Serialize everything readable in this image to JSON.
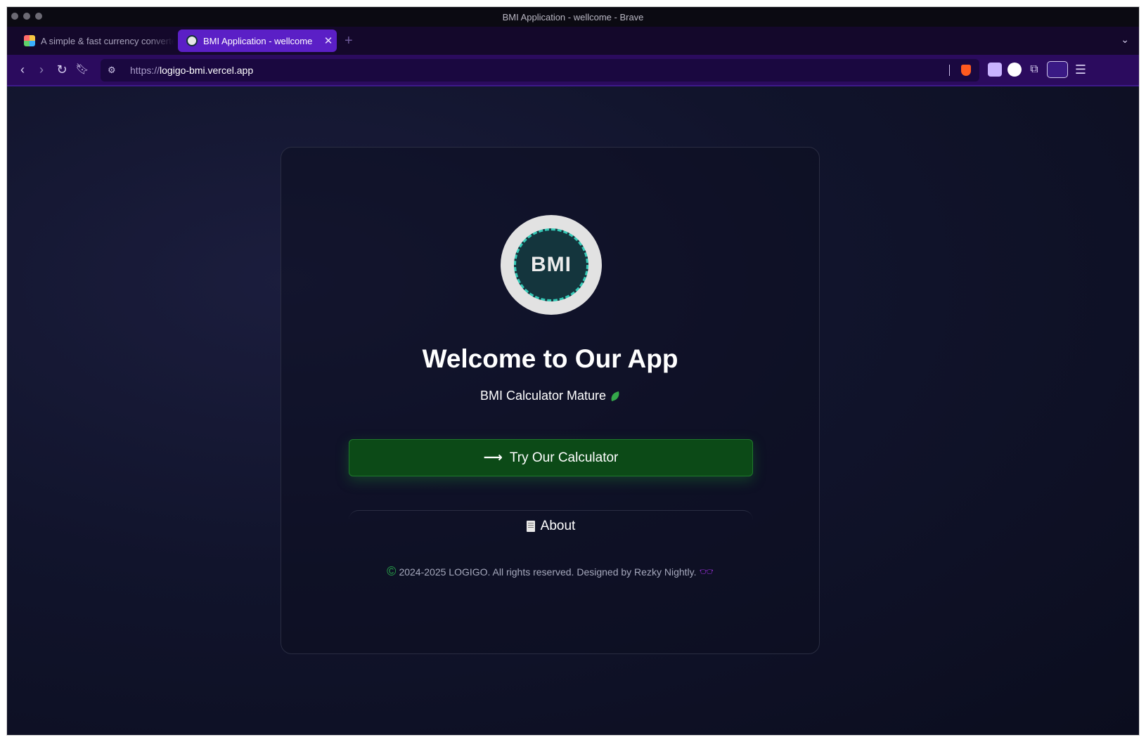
{
  "window": {
    "title": "BMI Application - wellcome - Brave"
  },
  "tabs": [
    {
      "label": "A simple & fast currency converter",
      "active": false
    },
    {
      "label": "BMI Application - wellcome",
      "active": true
    }
  ],
  "toolbar": {
    "url_scheme": "https://",
    "url_host": "logigo-bmi.vercel.app"
  },
  "page": {
    "logo_text": "BMI",
    "title": "Welcome to Our App",
    "subtitle": "BMI Calculator Mature",
    "cta_label": "Try Our Calculator",
    "about_label": "About",
    "footer_text": "2024-2025 LOGIGO. All rights reserved. Designed by Rezky Nightly."
  },
  "colors": {
    "cta_background": "#0c4a17",
    "page_background": "#11142c",
    "active_tab": "#5b1fc6",
    "toolbar": "#2b0b5e"
  },
  "icons": [
    "back-icon",
    "forward-icon",
    "reload-icon",
    "bookmark-icon",
    "site-info-icon",
    "brave-shield-icon",
    "extensions-icon",
    "menu-icon",
    "leaf-icon",
    "arrow-right-icon",
    "document-icon",
    "copyright-icon",
    "glasses-icon"
  ]
}
